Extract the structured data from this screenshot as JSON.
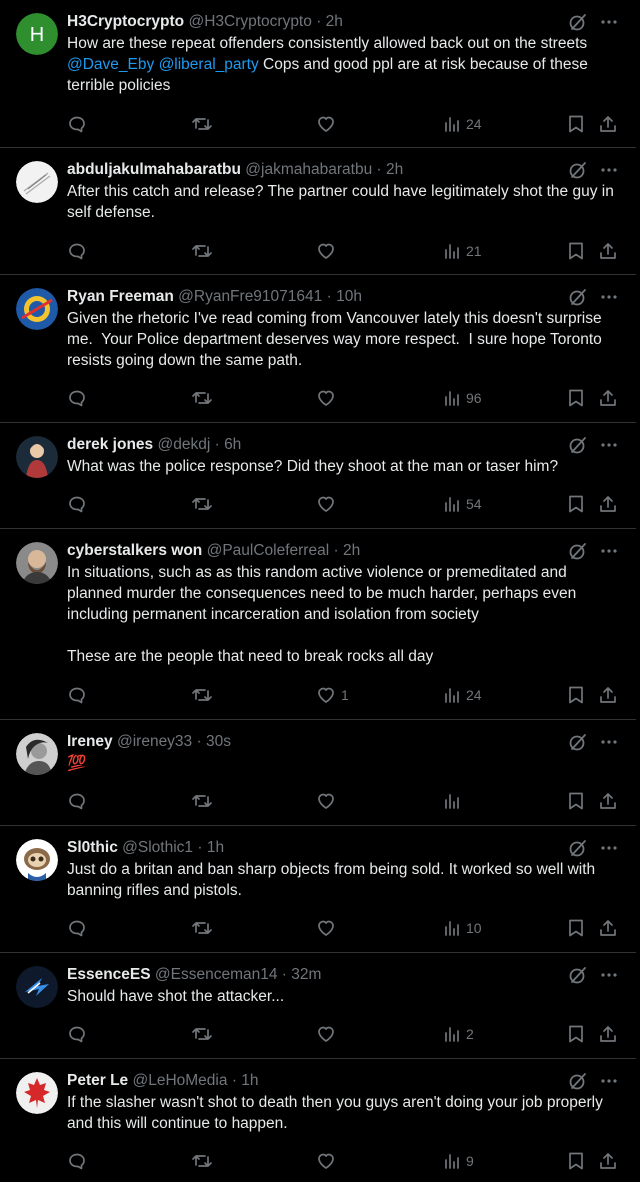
{
  "tweets": [
    {
      "name": "H3Cryptocrypto",
      "handle": "@H3Cryptocrypto",
      "separator": "·",
      "time": "2h",
      "text_parts": [
        "How are these repeat offenders consistently allowed back out on the streets ",
        "@Dave_Eby",
        " ",
        "@liberal_party",
        " Cops and good ppl are at risk because of these terrible policies"
      ],
      "likes": "",
      "views": "24",
      "avatar": "green-letter-h",
      "avatar_letter": "H",
      "avatar_color": "#2f8f2f"
    },
    {
      "name": "abduljakulmahabaratbu",
      "handle": "@jakmahabaratbu",
      "separator": "·",
      "time": "2h",
      "text_parts": [
        "After this catch and release? The partner could have legitimately shot the guy in self defense."
      ],
      "likes": "",
      "views": "21",
      "avatar": "white-sketch"
    },
    {
      "name": "Ryan Freeman",
      "handle": "@RyanFre91071641",
      "separator": "·",
      "time": "10h",
      "text_parts": [
        "Given the rhetoric I've read coming from Vancouver lately this doesn't surprise me.  Your Police department deserves way more respect.  I sure hope Toronto resists going down the same path."
      ],
      "likes": "",
      "views": "96",
      "avatar": "blue-team-logo"
    },
    {
      "name": "derek jones",
      "handle": "@dekdj",
      "separator": "·",
      "time": "6h",
      "text_parts": [
        "What was the police response? Did they shoot at the man or taser him?"
      ],
      "likes": "",
      "views": "54",
      "avatar": "illustrated-figure"
    },
    {
      "name": "cyberstalkers won",
      "handle": "@PaulColeferreal",
      "separator": "·",
      "time": "2h",
      "text_parts": [
        "In situations, such as as this random active violence or premeditated and planned murder the consequences need to be much harder, perhaps even including permanent incarceration and isolation from society\n\nThese are the people that need to break rocks all day"
      ],
      "likes": "1",
      "views": "24",
      "avatar": "bearded-man"
    },
    {
      "name": "Ireney",
      "handle": "@ireney33",
      "separator": "·",
      "time": "30s",
      "text_parts": [
        "💯"
      ],
      "likes": "",
      "views": "",
      "avatar": "grayscale-portrait"
    },
    {
      "name": "Sl0thic",
      "handle": "@Slothic1",
      "separator": "·",
      "time": "1h",
      "text_parts": [
        "Just do a britan and ban sharp objects from being sold. It worked so well with banning rifles and pistols."
      ],
      "likes": "",
      "views": "10",
      "avatar": "sloth-cartoon"
    },
    {
      "name": "EssenceES",
      "handle": "@Essenceman14",
      "separator": "·",
      "time": "32m",
      "text_parts": [
        "Should have shot the attacker..."
      ],
      "likes": "",
      "views": "2",
      "avatar": "blue-bird-logo"
    },
    {
      "name": "Peter Le",
      "handle": "@LeHoMedia",
      "separator": "·",
      "time": "1h",
      "text_parts": [
        "If the slasher wasn't shot to death then you guys aren't doing your job properly and this will continue to happen."
      ],
      "likes": "",
      "views": "9",
      "avatar": "red-maple-leaf"
    }
  ],
  "icons": {
    "grok": "grok-icon",
    "more": "more-icon",
    "reply": "reply-icon",
    "retweet": "retweet-icon",
    "like": "like-icon",
    "views": "views-icon",
    "bookmark": "bookmark-icon",
    "share": "share-icon"
  },
  "colors": {
    "background": "#000000",
    "text": "#e7e9ea",
    "muted": "#71767b",
    "link": "#1d9bf0",
    "divider": "#2f3336"
  }
}
